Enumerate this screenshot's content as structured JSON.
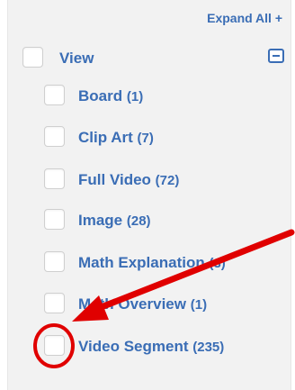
{
  "filter": {
    "expand_all": "Expand All +",
    "group": {
      "label": "View",
      "items": [
        {
          "label": "Board",
          "count": "(1)"
        },
        {
          "label": "Clip Art",
          "count": "(7)"
        },
        {
          "label": "Full Video",
          "count": "(72)"
        },
        {
          "label": "Image",
          "count": "(28)"
        },
        {
          "label": "Math Explanation",
          "count": "(3)"
        },
        {
          "label": "Math Overview",
          "count": "(1)"
        },
        {
          "label": "Video Segment",
          "count": "(235)"
        }
      ]
    }
  },
  "annotation": {
    "color": "#e00000"
  }
}
